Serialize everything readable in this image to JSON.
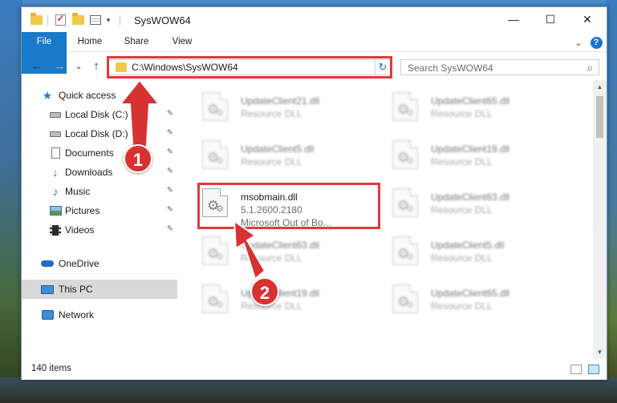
{
  "window": {
    "title": "SysWOW64",
    "minimize": "—",
    "maximize": "☐",
    "close": "✕"
  },
  "ribbon": {
    "tabs": [
      "File",
      "Home",
      "Share",
      "View"
    ],
    "collapse_icon": "chevron-down-icon",
    "help_label": "?"
  },
  "nav": {
    "back": "←",
    "forward": "→",
    "recent": "⌄",
    "up": "↑",
    "address": "C:\\Windows\\SysWOW64",
    "refresh": "↻",
    "search_placeholder": "Search SysWOW64",
    "search_icon": "⌕"
  },
  "sidebar": {
    "items": [
      {
        "label": "Quick access",
        "icon": "star-icon"
      },
      {
        "label": "Local Disk (C:)",
        "icon": "drive-icon",
        "pinned": true
      },
      {
        "label": "Local Disk (D:)",
        "icon": "drive-icon",
        "pinned": true
      },
      {
        "label": "Documents",
        "icon": "document-icon",
        "pinned": true
      },
      {
        "label": "Downloads",
        "icon": "download-icon",
        "pinned": true
      },
      {
        "label": "Music",
        "icon": "music-icon",
        "pinned": true
      },
      {
        "label": "Pictures",
        "icon": "pictures-icon",
        "pinned": true
      },
      {
        "label": "Videos",
        "icon": "videos-icon",
        "pinned": true
      },
      {
        "label": "OneDrive",
        "icon": "cloud-icon"
      },
      {
        "label": "This PC",
        "icon": "computer-icon",
        "selected": true
      },
      {
        "label": "Network",
        "icon": "network-icon"
      }
    ],
    "pin_glyph": "📌"
  },
  "files": [
    {
      "name": "UpdateClient21.dll",
      "desc": "Resource DLL",
      "blurred": true
    },
    {
      "name": "UpdateClient65.dll",
      "desc": "Resource DLL",
      "blurred": true
    },
    {
      "name": "UpdateClient5.dll",
      "desc": "Resource DLL",
      "blurred": true
    },
    {
      "name": "UpdateClient19.dll",
      "desc": "Resource DLL",
      "blurred": true
    },
    {
      "name": "msobmain.dll",
      "desc": "5.1.2600.2180",
      "desc2": "Microsoft Out of Bo...",
      "blurred": false
    },
    {
      "name": "UpdateClient63.dll",
      "desc": "Resource DLL",
      "blurred": true
    },
    {
      "name": "UpdateClient63.dll",
      "desc": "Resource DLL",
      "blurred": true
    },
    {
      "name": "UpdateClient5.dll",
      "desc": "Resource DLL",
      "blurred": true
    },
    {
      "name": "UpdateClient19.dll",
      "desc": "Resource DLL",
      "blurred": true
    },
    {
      "name": "UpdateClient65.dll",
      "desc": "Resource DLL",
      "blurred": true
    }
  ],
  "status": {
    "count": "140 items"
  },
  "callouts": {
    "step1": "1",
    "step2": "2",
    "accent": "#e03a3a"
  },
  "colors": {
    "file_tab": "#1979ca",
    "selection": "#d9d9d9"
  }
}
